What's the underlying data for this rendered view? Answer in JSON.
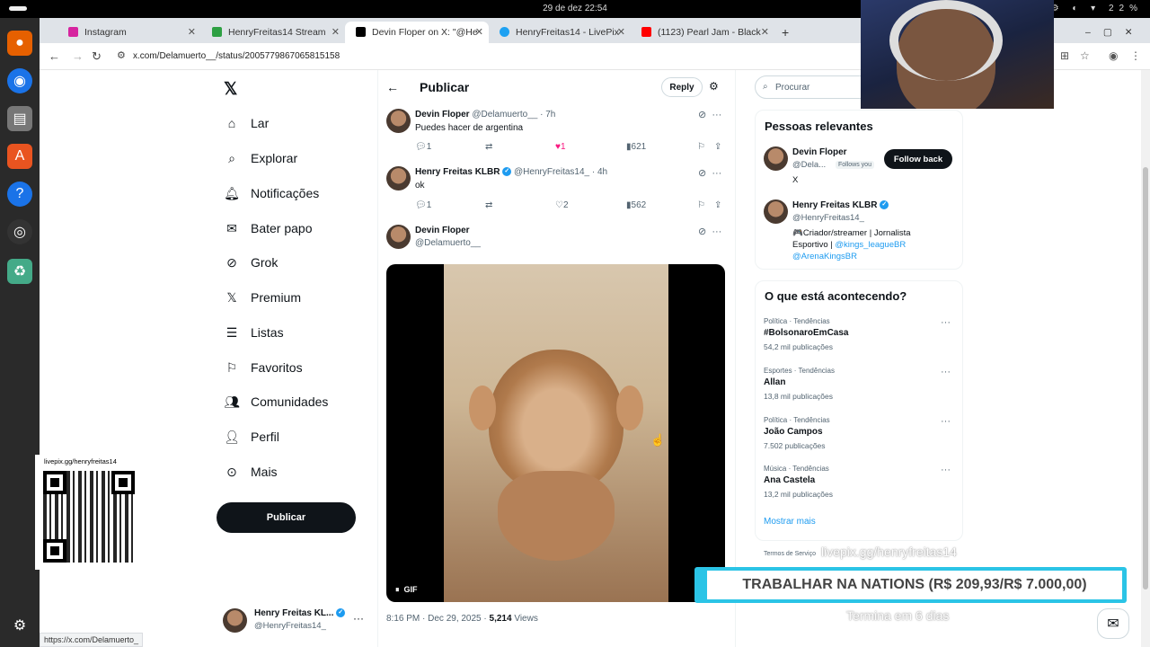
{
  "system": {
    "clock": "29 de dez  22:54",
    "battery": "22%",
    "status_url": "https://x.com/Delamuerto_"
  },
  "browser": {
    "tabs": [
      {
        "label": "Instagram",
        "color": "#d6249f"
      },
      {
        "label": "HenryFreitas14 Stream",
        "color": "#2ea043"
      },
      {
        "label": "Devin Floper on X: \"@He",
        "color": "#000000"
      },
      {
        "label": "HenryFreitas14 - LivePix",
        "color": "#1da1f2"
      },
      {
        "label": "(1123) Pearl Jam - Black",
        "color": "#ff0000"
      }
    ],
    "url": "x.com/Delamuerto__/status/2005779867065815158"
  },
  "nav": {
    "items": [
      {
        "label": "Lar",
        "icon": "home-icon"
      },
      {
        "label": "Explorar",
        "icon": "search-icon"
      },
      {
        "label": "Notificações",
        "icon": "bell-icon"
      },
      {
        "label": "Bater papo",
        "icon": "mail-icon"
      },
      {
        "label": "Grok",
        "icon": "grok-icon"
      },
      {
        "label": "Premium",
        "icon": "x-logo-icon"
      },
      {
        "label": "Listas",
        "icon": "list-icon"
      },
      {
        "label": "Favoritos",
        "icon": "bookmark-icon"
      },
      {
        "label": "Comunidades",
        "icon": "people-icon"
      },
      {
        "label": "Perfil",
        "icon": "person-icon"
      },
      {
        "label": "Mais",
        "icon": "more-circle-icon"
      }
    ],
    "post_button": "Publicar",
    "account": {
      "name": "Henry Freitas KL...",
      "handle": "@HenryFreitas14_"
    }
  },
  "header": {
    "title": "Publicar",
    "reply": "Reply"
  },
  "tweets": [
    {
      "name": "Devin Floper",
      "handle": "@Delamuerto__ · 7h",
      "text": "Puedes hacer de argentina",
      "replies": "1",
      "likes": "1",
      "views": "621"
    },
    {
      "name": "Henry Freitas KLBR",
      "handle": "@HenryFreitas14_ · 4h",
      "text": "ok",
      "replies": "1",
      "likes": "2",
      "views": "562"
    }
  ],
  "main_tweet": {
    "name": "Devin Floper",
    "handle": "@Delamuerto__",
    "gif_label": "GIF",
    "time": "8:16 PM · Dec 29, 2025 · ",
    "views": "5,214",
    "views_label": " Views"
  },
  "right": {
    "search_placeholder": "Procurar",
    "relevant_title": "Pessoas relevantes",
    "people": [
      {
        "name": "Devin Floper",
        "handle": "@Dela...",
        "follows": "Follows you",
        "button": "Follow back",
        "bio": "X"
      },
      {
        "name": "Henry Freitas KLBR",
        "handle": "@HenryFreitas14_",
        "bio": "🎮Criador/streamer | Jornalista Esportivo | ",
        "link1": "@kings_leagueBR",
        "link2": "@ArenaKingsBR"
      }
    ],
    "trends_title": "O que está acontecendo?",
    "trends": [
      {
        "cat": "Política · Tendências",
        "title": "#BolsonaroEmCasa",
        "count": "54,2 mil publicações"
      },
      {
        "cat": "Esportes · Tendências",
        "title": "Allan",
        "count": "13,8 mil publicações"
      },
      {
        "cat": "Política · Tendências",
        "title": "João Campos",
        "count": "7.502 publicações"
      },
      {
        "cat": "Música · Tendências",
        "title": "Ana Castela",
        "count": "13,2 mil publicações"
      }
    ],
    "show_more": "Mostrar mais",
    "terms": "Termos de Serviço"
  },
  "overlay": {
    "qr_label": "livepix.gg/henryfreitas14",
    "ghost_top": "livepix.gg/henryfreitas14",
    "banner": "TRABALHAR NA NATIONS (R$ 209,93/R$ 7.000,00)",
    "ghost_bottom": "Termina em 6 dias"
  }
}
